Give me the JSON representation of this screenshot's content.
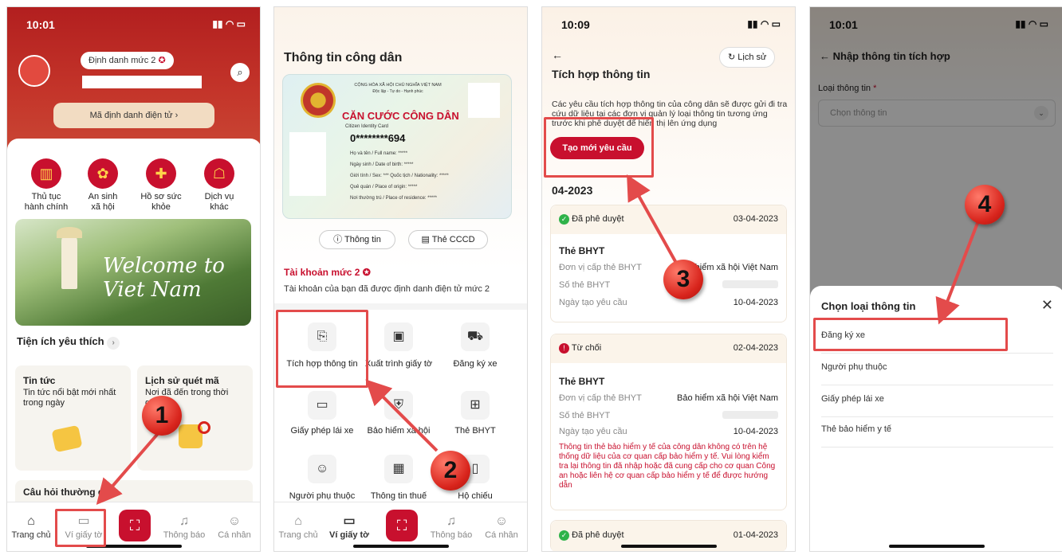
{
  "p1": {
    "time": "10:01",
    "badge": "Định danh mức 2",
    "identity_link": "Mã định danh điện tử",
    "services": [
      "Thủ tục\nhành chính",
      "An sinh\nxã hội",
      "Hồ sơ sức\nkhỏe",
      "Dịch vụ\nkhác"
    ],
    "banner": "Welcome to Viet Nam",
    "favorites_title": "Tiện ích yêu thích",
    "card1_title": "Tin tức",
    "card1_desc": "Tin tức nổi bật mới nhất trong ngày",
    "card2_title": "Lịch sử quét mã",
    "card2_desc": "Nơi đã đến trong thời gian",
    "faq_title": "Câu hỏi thường gặp",
    "nav": [
      "Trang chủ",
      "Ví giấy tờ",
      "Thông báo",
      "Cá nhân"
    ],
    "callout": "1"
  },
  "p2": {
    "title": "Thông tin công dân",
    "card_header": "CỘNG HÒA XÃ HỘI CHỦ NGHĨA VIỆT NAM",
    "card_motto": "Độc lập - Tự do - Hạnh phúc",
    "card_title": "CĂN CƯỚC CÔNG DÂN",
    "card_sub": "Citizen Identity Card",
    "card_number": "0********694",
    "card_fields": [
      "Họ và tên / Full name: *****",
      "Ngày sinh / Date of birth: *****",
      "Giới tính / Sex: ***   Quốc tịch / Nationality: *****",
      "Quê quán / Place of origin: *****",
      "Nơi thường trú / Place of residence: *****"
    ],
    "btn_info": "Thông tin",
    "btn_card": "Thẻ CCCD",
    "account_level": "Tài khoản mức 2",
    "account_desc": "Tài khoản của bạn đã được định danh điện tử mức 2",
    "grid": [
      "Tích hợp thông tin",
      "Xuất trình giấy tờ",
      "Đăng ký xe",
      "Giấy phép lái xe",
      "Bảo hiểm xã hội",
      "Thẻ BHYT",
      "Người phụ thuộc",
      "Thông tin thuế",
      "Hộ chiếu"
    ],
    "nav": [
      "Trang chủ",
      "Ví giấy tờ",
      "Thông báo",
      "Cá nhân"
    ],
    "callout": "2"
  },
  "p3": {
    "time": "10:09",
    "history": "Lịch sử",
    "title": "Tích hợp thông tin",
    "desc": "Các yêu cầu tích hợp thông tin của công dân sẽ được gửi đi tra cứu dữ liệu tại các đơn vị quản lý loại thông tin tương ứng trước khi phê duyệt để hiển thị lên ứng dụng",
    "create_btn": "Tạo mới yêu cầu",
    "month": "04-2023",
    "card1": {
      "status": "Đã phê duyệt",
      "date": "03-04-2023",
      "type": "Thẻ BHYT",
      "l1": "Đơn vị cấp thẻ BHYT",
      "v1": "Bảo hiểm xã hội Việt Nam",
      "l2": "Số thẻ BHYT",
      "l3": "Ngày tạo yêu cầu",
      "v3": "10-04-2023"
    },
    "card2": {
      "status": "Từ chối",
      "date": "02-04-2023",
      "type": "Thẻ BHYT",
      "l1": "Đơn vị cấp thẻ BHYT",
      "v1": "Bảo hiểm xã hội Việt Nam",
      "l2": "Số thẻ BHYT",
      "l3": "Ngày tạo yêu cầu",
      "v3": "10-04-2023",
      "error": "Thông tin thẻ bảo hiểm y tế của công dân không có trên hệ thống dữ liệu của cơ quan cấp bảo hiểm y tế. Vui lòng kiểm tra lại thông tin đã nhập hoặc đã cung cấp cho cơ quan Công an hoặc liên hệ cơ quan cấp bảo hiểm y tế để được hướng dẫn"
    },
    "card3": {
      "status": "Đã phê duyệt",
      "date": "01-04-2023"
    },
    "callout": "3"
  },
  "p4": {
    "time": "10:01",
    "title": "Nhập thông tin tích hợp",
    "field_label": "Loại thông tin",
    "field_placeholder": "Chọn thông tin",
    "sheet_title": "Chọn loại thông tin",
    "options": [
      "Đăng ký xe",
      "Người phụ thuộc",
      "Giấy phép lái xe",
      "Thẻ bảo hiểm y tế"
    ],
    "callout": "4"
  },
  "colors": {
    "primary_red": "#c8102e",
    "callout_red": "#d8241c",
    "highlight": "#e34b4b"
  }
}
